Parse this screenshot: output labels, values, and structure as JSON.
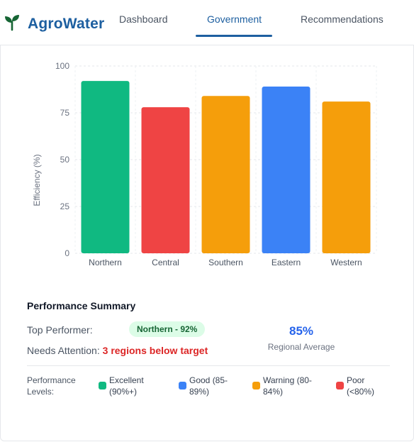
{
  "app": {
    "name": "AgroWater",
    "icon": "sprout-icon"
  },
  "nav": {
    "tabs": [
      {
        "label": "Dashboard",
        "active": false
      },
      {
        "label": "Government",
        "active": true
      },
      {
        "label": "Recommendations",
        "active": false
      }
    ]
  },
  "chart_data": {
    "type": "bar",
    "categories": [
      "Northern",
      "Central",
      "Southern",
      "Eastern",
      "Western"
    ],
    "values": [
      92,
      78,
      84,
      89,
      81
    ],
    "colors": [
      "#10b981",
      "#ef4444",
      "#f59e0b",
      "#3b82f6",
      "#f59e0b"
    ],
    "title": "",
    "xlabel": "",
    "ylabel": "Efficiency (%)",
    "ylim": [
      0,
      100
    ],
    "yticks": [
      0,
      25,
      50,
      75,
      100
    ],
    "grid": true,
    "legend": "none"
  },
  "summary": {
    "title": "Performance Summary",
    "top_performer_label": "Top Performer:",
    "top_performer_value": "Northern - 92%",
    "attention_label": "Needs Attention:",
    "attention_value": "3 regions below target",
    "average_value": "85%",
    "average_label": "Regional Average"
  },
  "legend": {
    "title": "Performance Levels:",
    "items": [
      {
        "label": "Excellent (90%+)",
        "color": "#10b981"
      },
      {
        "label": "Good (85-89%)",
        "color": "#3b82f6"
      },
      {
        "label": "Warning (80-84%)",
        "color": "#f59e0b"
      },
      {
        "label": "Poor (<80%)",
        "color": "#ef4444"
      }
    ]
  }
}
